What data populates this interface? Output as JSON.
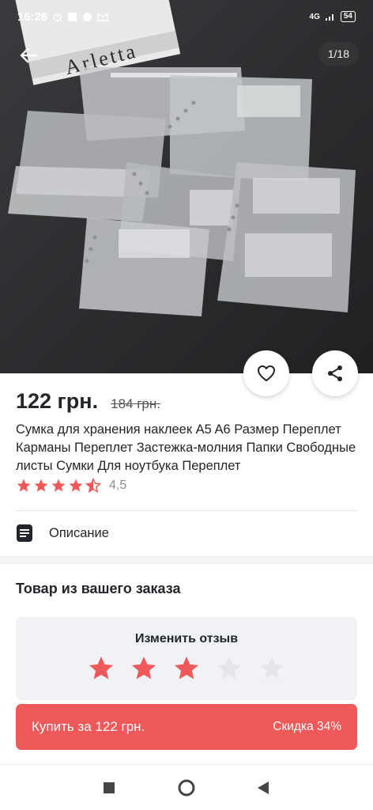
{
  "status_bar": {
    "time": "16:26",
    "network": "4G",
    "battery": "54"
  },
  "gallery": {
    "counter": "1/18",
    "box_text": "Arletta"
  },
  "product": {
    "price": "122 грн.",
    "old_price": "184 грн.",
    "title": "Сумка для хранения наклеек A5 A6 Размер Переплет Карманы Переплет Застежка-молния Папки Свободные листы Сумки Для ноутбука Переплет",
    "rating_value": "4,5",
    "rating_score": 4.5,
    "rating_max": 5
  },
  "description": {
    "label": "Описание"
  },
  "order_section": {
    "title": "Товар из вашего заказа",
    "review_label": "Изменить отзыв",
    "user_rating": 3,
    "max_rating": 5
  },
  "buy": {
    "label": "Купить за 122 грн.",
    "discount": "Скидка 34%"
  },
  "colors": {
    "accent": "#f0595a",
    "star_filled": "#f0595a",
    "star_empty": "#e4e6ea",
    "text": "#22262b"
  },
  "icons": {
    "back": "arrow-left-icon",
    "favorite": "heart-icon",
    "share": "share-icon",
    "description": "document-icon",
    "nav_recent": "square-icon",
    "nav_home": "circle-icon",
    "nav_back": "triangle-icon"
  }
}
